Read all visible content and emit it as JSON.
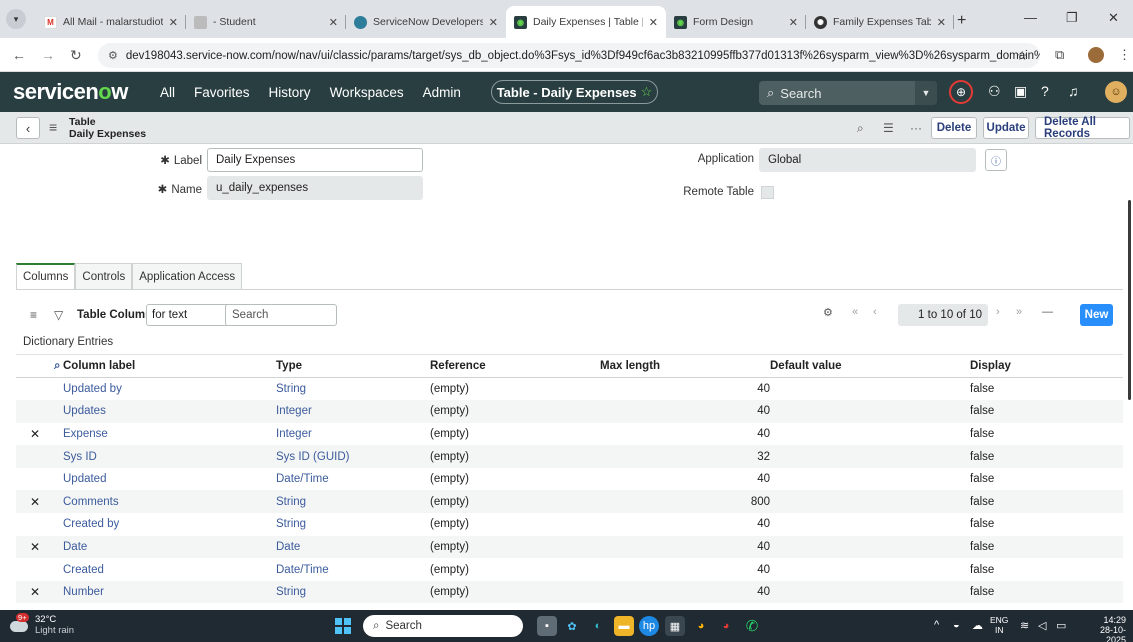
{
  "browser": {
    "tabs": [
      {
        "title": "All Mail - malarstudiotcr@",
        "favicon": "gmail-icon",
        "active": false
      },
      {
        "title": "- Student",
        "favicon": "student-icon",
        "active": false
      },
      {
        "title": "ServiceNow Developers",
        "favicon": "servicenow-dev-icon",
        "active": false
      },
      {
        "title": "Daily Expenses | Table | Ser",
        "favicon": "servicenow-icon",
        "active": true
      },
      {
        "title": "Form Design",
        "favicon": "servicenow-icon",
        "active": false
      },
      {
        "title": "Family Expenses Table Cre",
        "favicon": "chatgpt-icon",
        "active": false
      }
    ],
    "url": "dev198043.service-now.com/now/nav/ui/classic/params/target/sys_db_object.do%3Fsys_id%3Df949cf6ac3b83210995ffb377d01313f%26sysparm_view%3D%26sysparm_domain%3Dnull%26sys..."
  },
  "header": {
    "logo": "servicenow",
    "nav": [
      "All",
      "Favorites",
      "History",
      "Workspaces",
      "Admin"
    ],
    "context_pill": "Table - Daily Expenses",
    "search_placeholder": "Search"
  },
  "formbar": {
    "title_line1": "Table",
    "title_line2": "Daily Expenses",
    "buttons": [
      "Delete",
      "Update",
      "Delete All Records"
    ]
  },
  "form": {
    "label_label": "Label",
    "label_value": "Daily Expenses",
    "name_label": "Name",
    "name_value": "u_daily_expenses",
    "application_label": "Application",
    "application_value": "Global",
    "remote_table_label": "Remote Table"
  },
  "related_tabs": [
    "Columns",
    "Controls",
    "Application Access"
  ],
  "list": {
    "title": "Table Columns",
    "filter_field": "for text",
    "search_placeholder": "Search",
    "pagination": "1 to 10 of 10",
    "new_label": "New",
    "section_label": "Dictionary Entries",
    "headers": [
      "Column label",
      "Type",
      "Reference",
      "Max length",
      "Default value",
      "Display"
    ],
    "rows": [
      {
        "delete": false,
        "label": "Updated by",
        "type": "String",
        "reference": "(empty)",
        "max": "40",
        "default": "",
        "display": "false"
      },
      {
        "delete": false,
        "label": "Updates",
        "type": "Integer",
        "reference": "(empty)",
        "max": "40",
        "default": "",
        "display": "false"
      },
      {
        "delete": true,
        "label": "Expense",
        "type": "Integer",
        "reference": "(empty)",
        "max": "40",
        "default": "",
        "display": "false"
      },
      {
        "delete": false,
        "label": "Sys ID",
        "type": "Sys ID (GUID)",
        "reference": "(empty)",
        "max": "32",
        "default": "",
        "display": "false"
      },
      {
        "delete": false,
        "label": "Updated",
        "type": "Date/Time",
        "reference": "(empty)",
        "max": "40",
        "default": "",
        "display": "false"
      },
      {
        "delete": true,
        "label": "Comments",
        "type": "String",
        "reference": "(empty)",
        "max": "800",
        "default": "",
        "display": "false"
      },
      {
        "delete": false,
        "label": "Created by",
        "type": "String",
        "reference": "(empty)",
        "max": "40",
        "default": "",
        "display": "false"
      },
      {
        "delete": true,
        "label": "Date",
        "type": "Date",
        "reference": "(empty)",
        "max": "40",
        "default": "",
        "display": "false"
      },
      {
        "delete": false,
        "label": "Created",
        "type": "Date/Time",
        "reference": "(empty)",
        "max": "40",
        "default": "",
        "display": "false"
      },
      {
        "delete": true,
        "label": "Number",
        "type": "String",
        "reference": "(empty)",
        "max": "40",
        "default": "",
        "display": "false"
      }
    ]
  },
  "taskbar": {
    "temperature": "32°C",
    "weather": "Light rain",
    "weather_badge": "9+",
    "search_label": "Search",
    "lang_line1": "ENG",
    "lang_line2": "IN",
    "time": "14:29",
    "date": "28-10-2025"
  },
  "colors": {
    "sn_header": "#293e40",
    "link": "#3b5b9c",
    "new_button": "#278efc",
    "delete_x": "#c62828"
  }
}
